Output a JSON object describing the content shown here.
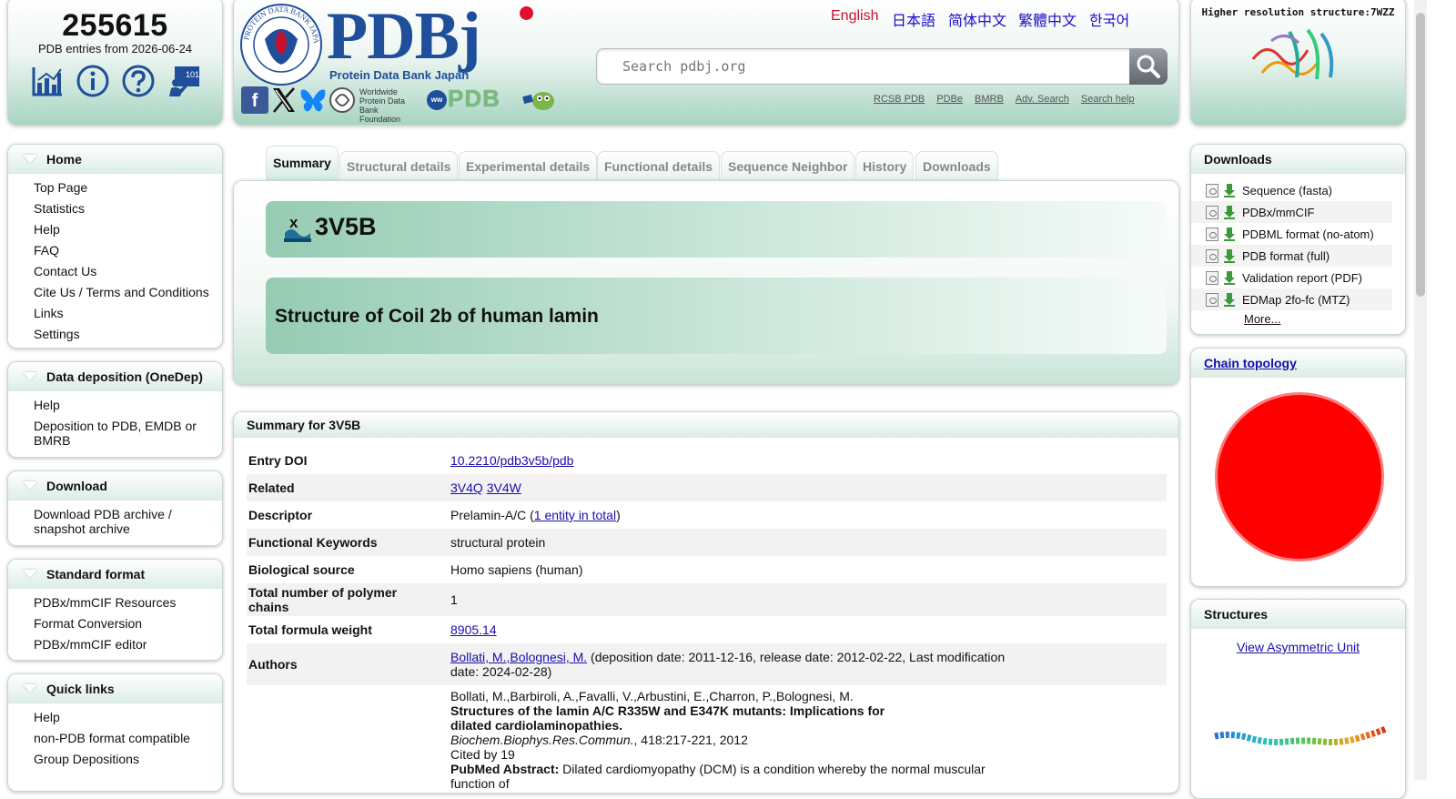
{
  "counter": {
    "count": "255615",
    "subtitle": "PDB entries from 2026-06-24",
    "icons": [
      "chart-icon",
      "info-icon",
      "help-icon",
      "tutorial-icon"
    ]
  },
  "header": {
    "logo_text": "PDBj",
    "logo_sub": "Protein Data Bank Japan",
    "seal_text": "PROTEIN DATA BANK JAPAN",
    "wwpdb_foundation": [
      "Worldwide",
      "Protein Data Bank",
      "Foundation"
    ],
    "wwpdb_text": "PDB",
    "languages": [
      "English",
      "日本語",
      "简体中文",
      "繁體中文",
      "한국어"
    ],
    "search_placeholder": "Search pdbj.org",
    "links": [
      "RCSB PDB",
      "PDBe",
      "BMRB",
      "Adv. Search",
      "Search help"
    ]
  },
  "hires": {
    "title": "Higher resolution structure:7WZZ"
  },
  "sidebar": {
    "home": {
      "title": "Home",
      "items": [
        "Top Page",
        "Statistics",
        "Help",
        "FAQ",
        "Contact Us",
        "Cite Us / Terms and Conditions",
        "Links",
        "Settings"
      ]
    },
    "deposition": {
      "title": "Data deposition (OneDep)",
      "items": [
        "Help",
        "Deposition to PDB, EMDB or BMRB"
      ]
    },
    "download": {
      "title": "Download",
      "items": [
        "Download PDB archive / snapshot archive"
      ]
    },
    "standard": {
      "title": "Standard format",
      "items": [
        "PDBx/mmCIF Resources",
        "Format Conversion",
        "PDBx/mmCIF editor"
      ]
    },
    "quick": {
      "title": "Quick links",
      "items": [
        "Help",
        "non-PDB format compatible",
        "Group Depositions"
      ]
    }
  },
  "tabs": [
    "Summary",
    "Structural details",
    "Experimental details",
    "Functional details",
    "Sequence Neighbor",
    "History",
    "Downloads"
  ],
  "entry": {
    "id": "3V5B",
    "title": "Structure of Coil 2b of human lamin"
  },
  "summary": {
    "heading": "Summary for 3V5B",
    "doi_label": "Entry DOI",
    "doi": "10.2210/pdb3v5b/pdb",
    "related_label": "Related",
    "related": [
      "3V4Q",
      "3V4W"
    ],
    "descriptor_label": "Descriptor",
    "descriptor": "Prelamin-A/C (",
    "descriptor_link": "1 entity in total",
    "descriptor_end": ")",
    "keywords_label": "Functional Keywords",
    "keywords": "structural protein",
    "source_label": "Biological source",
    "source": "Homo sapiens (human)",
    "chains_label": "Total number of polymer chains",
    "chains": "1",
    "weight_label": "Total formula weight",
    "weight": "8905.14",
    "authors_label": "Authors",
    "authors_link": "Bollati, M.,Bolognesi, M.",
    "authors_dates": " (deposition date: 2011-12-16, release date: 2012-02-22, Last modification date: 2024-02-28)",
    "citation_authors": "Bollati, M.,Barbiroli, A.,Favalli, V.,Arbustini, E.,Charron, P.,Bolognesi, M.",
    "citation_title": "Structures of the lamin A/C R335W and E347K mutants: Implications for dilated cardiolaminopathies.",
    "citation_journal": "Biochem.Biophys.Res.Commun.",
    "citation_pages": ", 418:217-221, 2012",
    "cited_by": "Cited by 19",
    "abstract_label": "PubMed Abstract:",
    "abstract": " Dilated cardiomyopathy (DCM) is a condition whereby the normal muscular function of"
  },
  "downloads": {
    "title": "Downloads",
    "items": [
      "Sequence (fasta)",
      "PDBx/mmCIF",
      "PDBML format (no-atom)",
      "PDB format (full)",
      "Validation report (PDF)",
      "EDMap 2fo-fc (MTZ)"
    ],
    "more": "More..."
  },
  "topology": {
    "title": "Chain topology",
    "circle_color": "#ff0000"
  },
  "structures": {
    "title": "Structures",
    "link": "View Asymmetric Unit"
  },
  "colors": {
    "accent_green": "#a8d4c2",
    "language_active": "#c8102e",
    "link": "#1a0dab"
  }
}
